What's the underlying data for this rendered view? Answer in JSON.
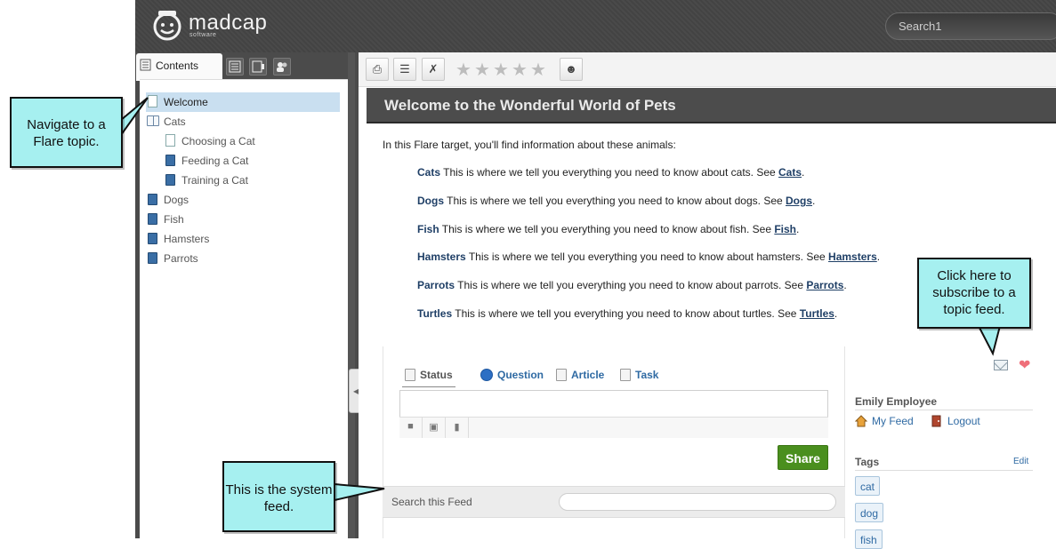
{
  "header": {
    "brand": "madcap",
    "brand_sub": "software",
    "search_placeholder": "Search1"
  },
  "nav_tabs": {
    "contents_label": "Contents"
  },
  "toc": {
    "items": [
      {
        "label": "Welcome",
        "type": "page",
        "selected": true
      },
      {
        "label": "Cats",
        "type": "open-book"
      },
      {
        "label": "Choosing a Cat",
        "type": "page",
        "child": true
      },
      {
        "label": "Feeding a Cat",
        "type": "book",
        "child": true
      },
      {
        "label": "Training a Cat",
        "type": "book",
        "child": true
      },
      {
        "label": "Dogs",
        "type": "book"
      },
      {
        "label": "Fish",
        "type": "book"
      },
      {
        "label": "Hamsters",
        "type": "book"
      },
      {
        "label": "Parrots",
        "type": "book"
      }
    ]
  },
  "topic": {
    "title": "Welcome to the Wonderful World of Pets",
    "intro": "In this Flare target, you'll find information about these animals:",
    "animals": [
      {
        "name": "Cats",
        "text": " This is where we tell you everything you need to know about cats. See ",
        "link": "Cats"
      },
      {
        "name": "Dogs",
        "text": " This is where we tell you everything you need to know about dogs. See ",
        "link": "Dogs"
      },
      {
        "name": "Fish",
        "text": " This is where we tell you everything you need to know about fish. See ",
        "link": "Fish"
      },
      {
        "name": "Hamsters",
        "text": " This is where we tell you everything you need to know about hamsters. See ",
        "link": "Hamsters"
      },
      {
        "name": "Parrots",
        "text": " This is where we tell you everything you need to know about parrots. See ",
        "link": "Parrots"
      },
      {
        "name": "Turtles",
        "text": " This is where we tell you everything you need to know about turtles. See ",
        "link": "Turtles"
      }
    ]
  },
  "feed": {
    "tabs": {
      "status": "Status",
      "question": "Question",
      "article": "Article",
      "task": "Task"
    },
    "share_label": "Share",
    "search_label": "Search this Feed"
  },
  "sidebar": {
    "user_name": "Emily Employee",
    "my_feed": "My Feed",
    "logout": "Logout",
    "tags_title": "Tags",
    "tags_edit": "Edit",
    "tags": [
      "cat",
      "dog",
      "fish"
    ]
  },
  "callouts": {
    "navigate": "Navigate to a Flare topic.",
    "subscribe": "Click here to subscribe to a topic feed.",
    "system_feed": "This is the system feed."
  },
  "colors": {
    "header_bg": "#4a4a4a",
    "title_bar_bg": "#4c4c4c",
    "toc_selected": "#c9dff0",
    "link": "#1f3f66",
    "share_button": "#4a8f1e",
    "callout_bg": "#a6f0f0"
  }
}
